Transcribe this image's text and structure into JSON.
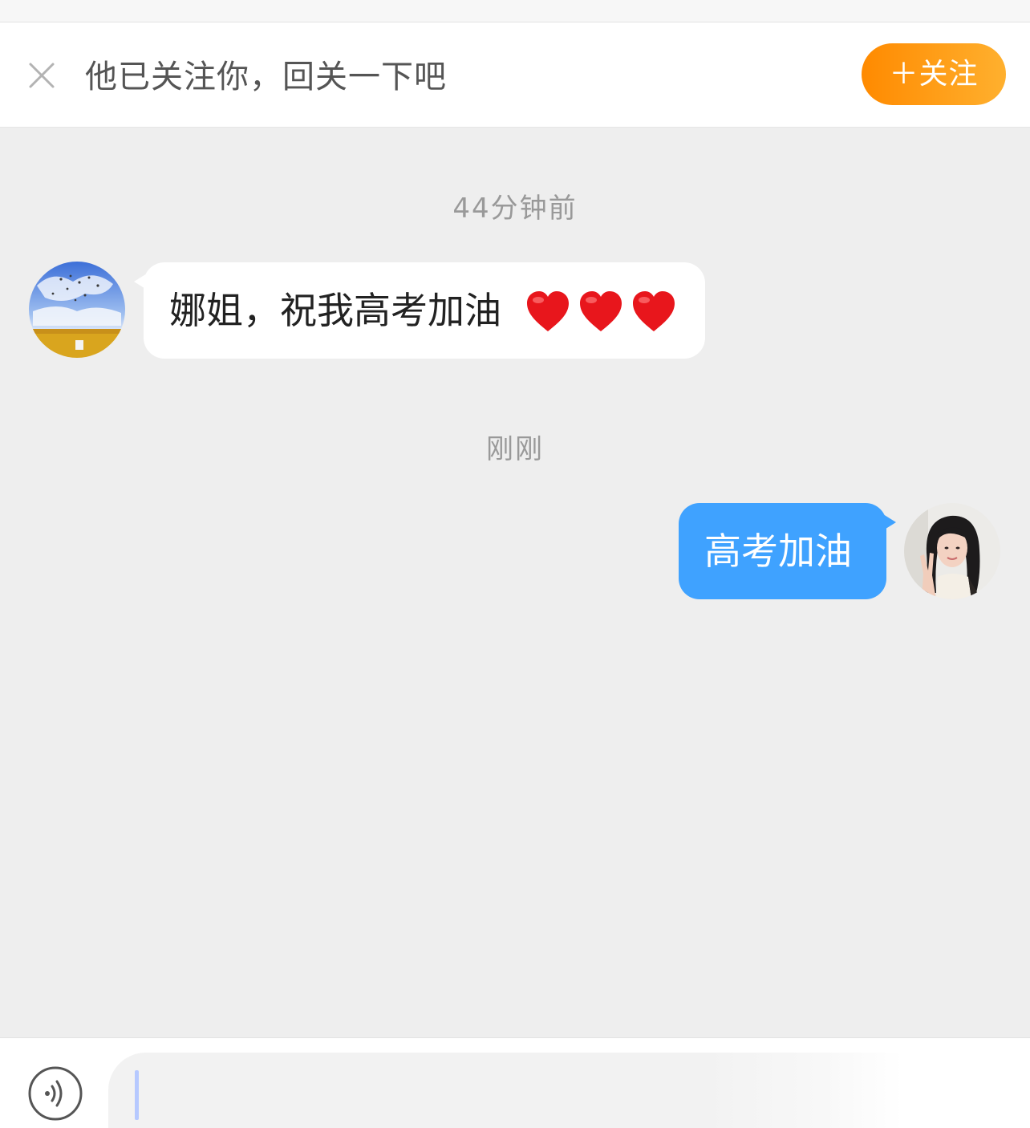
{
  "follow_prompt": {
    "close_icon": "close-icon",
    "text": "他已关注你，回关一下吧",
    "button_label": "＋关注",
    "button_gradient": [
      "#ff8a00",
      "#ffb02e"
    ]
  },
  "messages": [
    {
      "timestamp": "44分钟前",
      "direction": "incoming",
      "avatar_icon": "sunflower-field-avatar",
      "text": "娜姐，祝我高考加油",
      "emoji": [
        "red-heart",
        "red-heart",
        "red-heart"
      ]
    },
    {
      "timestamp": "刚刚",
      "direction": "outgoing",
      "avatar_icon": "girl-peace-sign-avatar",
      "text": "高考加油",
      "bubble_color": "#3fa2ff"
    }
  ],
  "composer": {
    "voice_icon": "voice-wave-icon",
    "input_value": ""
  }
}
